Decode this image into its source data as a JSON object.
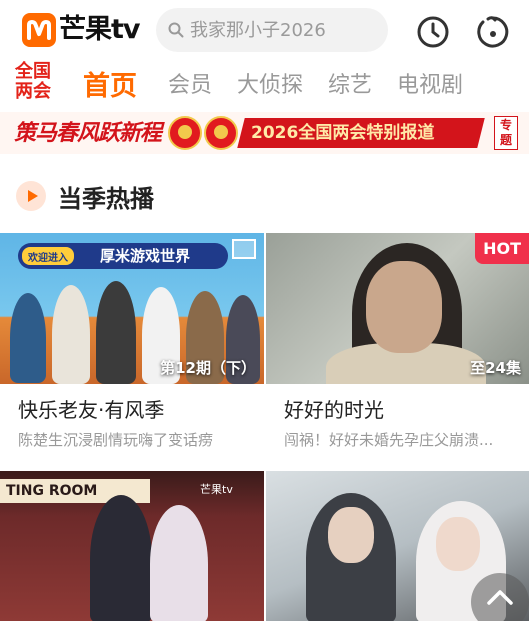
{
  "app": {
    "logo_text": "芒果tv",
    "brand_color": "#ff6a00"
  },
  "search": {
    "placeholder": "我家那小子2026"
  },
  "header_icons": [
    "history-clock-icon",
    "profile-face-icon"
  ],
  "nav": {
    "badge_lines": [
      "全国",
      "两会"
    ],
    "tabs": [
      {
        "label": "首页",
        "active": true
      },
      {
        "label": "会员",
        "active": false
      },
      {
        "label": "大侦探",
        "active": false
      },
      {
        "label": "综艺",
        "active": false
      },
      {
        "label": "电视剧",
        "active": false
      }
    ]
  },
  "banner": {
    "slogan": "策马春风跃新程",
    "ribbon": "2026全国两会特别报道",
    "tag": "专题"
  },
  "section": {
    "title": "当季热播"
  },
  "cards": [
    {
      "title": "快乐老友·有风季",
      "subtitle": "陈楚生沉浸剧情玩嗨了变话痨",
      "episode": "第12期（下）",
      "thumb_text_a": "欢迎进入",
      "thumb_text_b": "厚米游戏世界"
    },
    {
      "title": "好好的时光",
      "subtitle": "闯祸！好好未婚先孕庄父崩溃...",
      "episode": "至24集",
      "badge": "HOT"
    },
    {
      "thumb_text": "TING ROOM",
      "watermark": "芒果tv"
    },
    {
      "thumb_text": ""
    }
  ]
}
